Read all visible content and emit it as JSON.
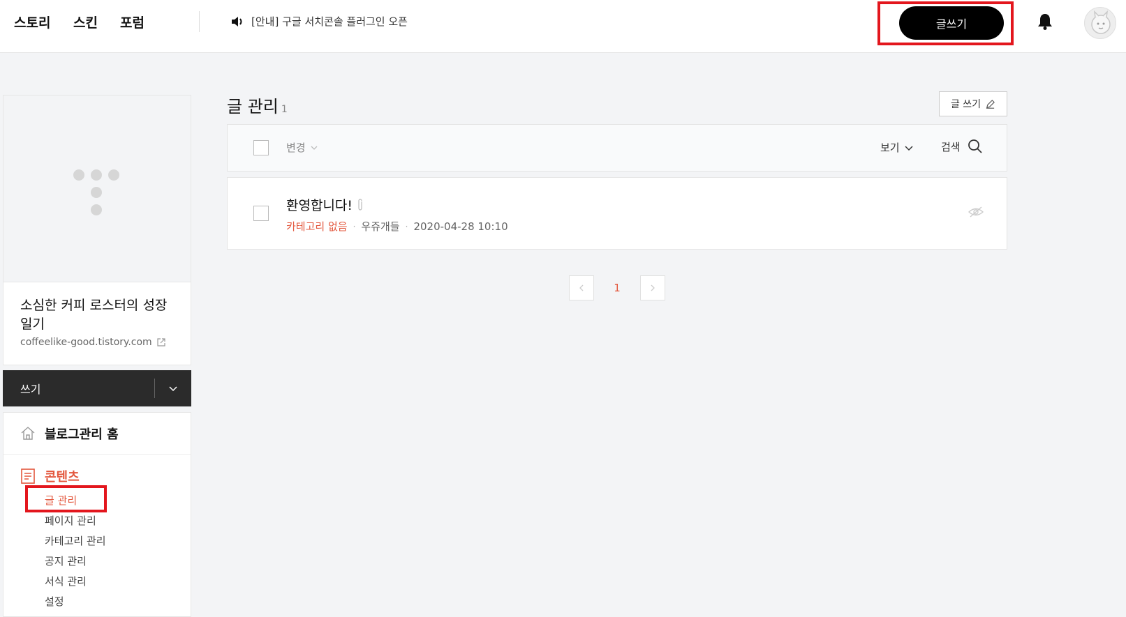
{
  "header": {
    "nav": [
      "스토리",
      "스킨",
      "포럼"
    ],
    "notice": "[안내] 구글 서치콘솔 플러그인 오픈",
    "write_button": "글쓰기"
  },
  "sidebar": {
    "blog_title": "소심한 커피 로스터의 성장 일기",
    "blog_url": "coffeelike-good.tistory.com",
    "write_menu": "쓰기",
    "home": "블로그관리 홈",
    "contents": "콘텐츠",
    "sub_items": [
      "글 관리",
      "페이지 관리",
      "카테고리 관리",
      "공지 관리",
      "서식 관리",
      "설정"
    ]
  },
  "main": {
    "title": "글 관리",
    "count": "1",
    "small_write": "글 쓰기",
    "toolbar": {
      "change": "변경",
      "view": "보기",
      "search": "검색"
    },
    "posts": [
      {
        "title": "환영합니다!",
        "category": "카테고리 없음",
        "author": "우쥬개들",
        "date": "2020-04-28 10:10"
      }
    ],
    "pagination": {
      "current": "1"
    }
  },
  "colors": {
    "accent": "#e3573d",
    "highlight": "#e3161d",
    "dark": "#2b2b2b"
  }
}
